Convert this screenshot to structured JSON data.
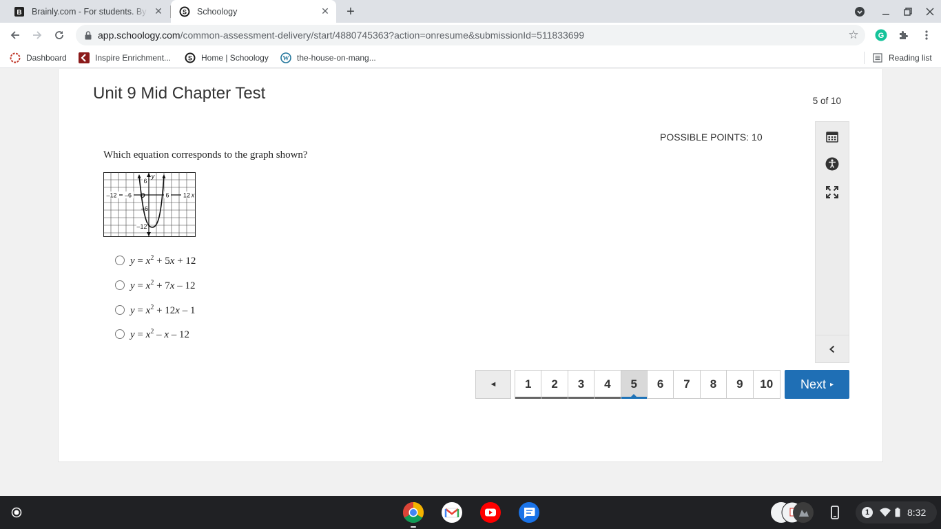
{
  "browser": {
    "tabs": [
      {
        "title": "Brainly.com - For students. By st",
        "favicon": "brainly-icon",
        "active": false
      },
      {
        "title": "Schoology",
        "favicon": "schoology-icon",
        "active": true
      }
    ],
    "url_host": "app.schoology.com",
    "url_path": "/common-assessment-delivery/start/4880745363?action=onresume&submissionId=511833699",
    "bookmarks": [
      {
        "label": "Dashboard",
        "icon": "dashboard-icon"
      },
      {
        "label": "Inspire Enrichment...",
        "icon": "inspire-icon"
      },
      {
        "label": "Home | Schoology",
        "icon": "schoology-icon"
      },
      {
        "label": "the-house-on-mang...",
        "icon": "wordpress-icon"
      }
    ],
    "reading_list": "Reading list"
  },
  "test": {
    "title": "Unit 9 Mid Chapter Test",
    "progress": "5 of 10",
    "points": "POSSIBLE POINTS: 10",
    "question": "Which equation corresponds to the graph shown?",
    "graph_labels": {
      "y_axis": "y",
      "x_axis": "x",
      "origin": "O",
      "y_top": "6",
      "y_mid": "–6",
      "y_low": "–12",
      "x_left_far": "–12",
      "x_left": "–6",
      "x_right": "6",
      "x_right_far": "12"
    },
    "choices": [
      {
        "parts": [
          "y",
          " = ",
          "x",
          "2",
          " + 5",
          "x",
          " + 12"
        ]
      },
      {
        "parts": [
          "y",
          " = ",
          "x",
          "2",
          " + 7",
          "x",
          " – 12"
        ]
      },
      {
        "parts": [
          "y",
          " = ",
          "x",
          "2",
          " + 12",
          "x",
          " – 1"
        ]
      },
      {
        "parts": [
          "y",
          " = ",
          "x",
          "2",
          " – ",
          "x",
          " – 12"
        ]
      }
    ],
    "pages": [
      "1",
      "2",
      "3",
      "4",
      "5",
      "6",
      "7",
      "8",
      "9",
      "10"
    ],
    "current_page": "5",
    "prev_label": "◄",
    "next_label": "Next",
    "next_arrow": "▸"
  },
  "tools": [
    "calendar-icon",
    "accessibility-icon",
    "fullscreen-icon",
    "collapse-chevron-icon"
  ],
  "shelf": {
    "apps": [
      "chrome-icon",
      "gmail-icon",
      "youtube-icon",
      "messages-icon"
    ],
    "notification_count": "1",
    "time": "8:32"
  }
}
